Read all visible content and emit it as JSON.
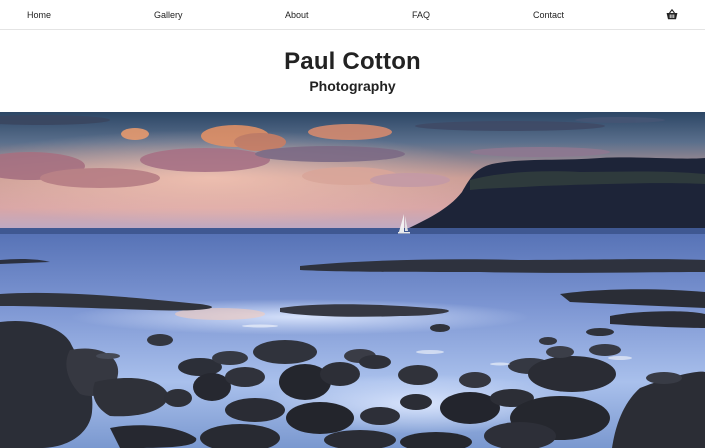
{
  "nav": {
    "items": [
      {
        "label": "Home"
      },
      {
        "label": "Gallery"
      },
      {
        "label": "About"
      },
      {
        "label": "FAQ"
      },
      {
        "label": "Contact"
      }
    ],
    "cart_icon": "basket-icon"
  },
  "brand": {
    "title": "Paul Cotton",
    "subtitle": "Photography"
  },
  "colors": {
    "text": "#222222",
    "divider": "#e4e4e4",
    "sky_top": "#2f4a6a",
    "sunset_orange": "#f0a070",
    "sea_blue": "#6a86c4",
    "rock": "#2a2f3c"
  }
}
